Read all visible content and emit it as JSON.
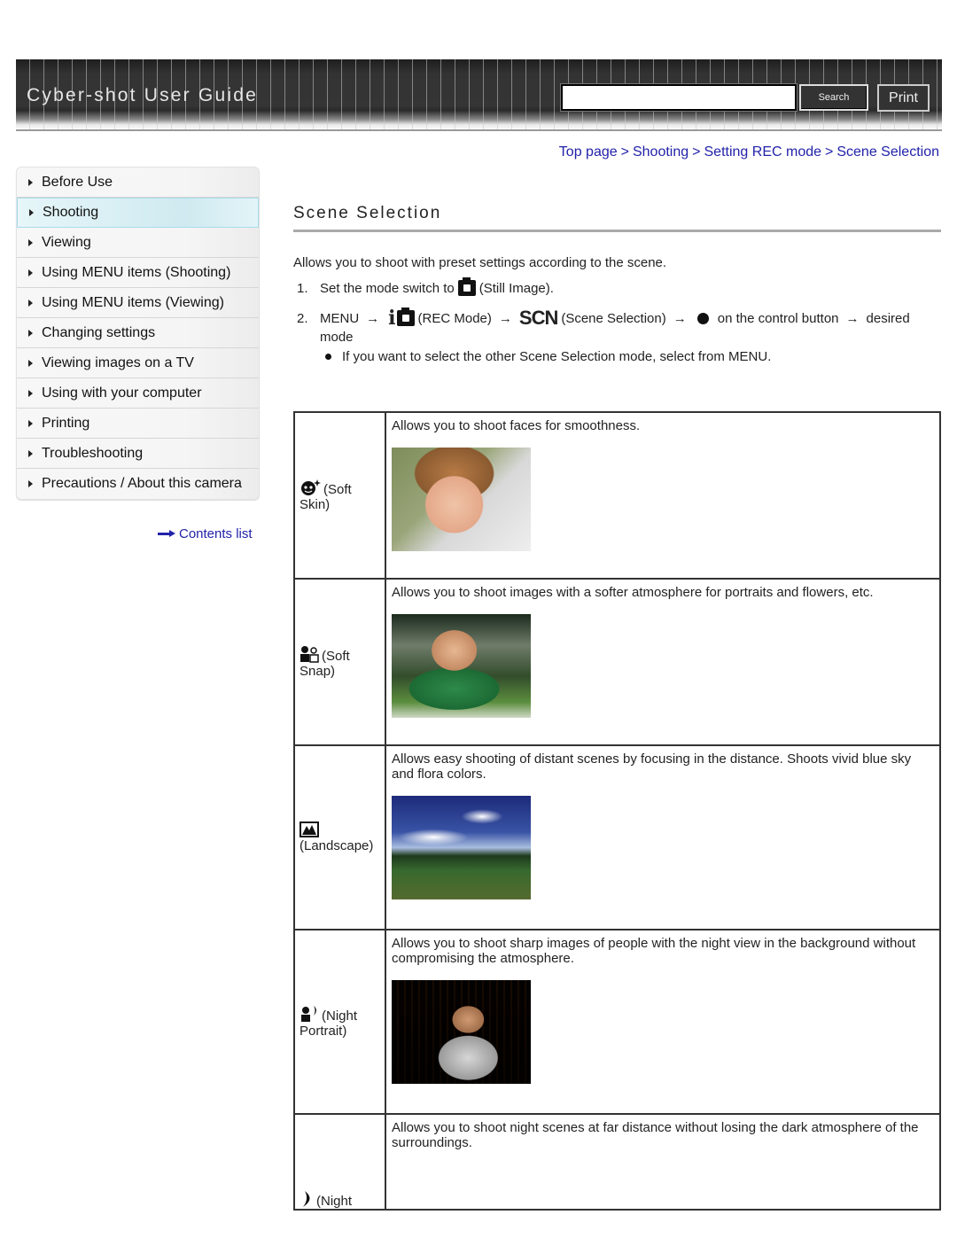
{
  "header": {
    "title": "Cyber-shot User Guide",
    "search_placeholder": "",
    "search_value": "",
    "search_button": "Search",
    "print_button": "Print"
  },
  "breadcrumb": {
    "items": [
      "Top page",
      "Shooting",
      "Setting REC mode",
      "Scene Selection"
    ],
    "separator": ">"
  },
  "sidebar": {
    "items": [
      {
        "label": "Before Use",
        "active": false
      },
      {
        "label": "Shooting",
        "active": true
      },
      {
        "label": "Viewing",
        "active": false
      },
      {
        "label": "Using MENU items (Shooting)",
        "active": false
      },
      {
        "label": "Using MENU items (Viewing)",
        "active": false
      },
      {
        "label": "Changing settings",
        "active": false
      },
      {
        "label": "Viewing images on a TV",
        "active": false
      },
      {
        "label": "Using with your computer",
        "active": false
      },
      {
        "label": "Printing",
        "active": false
      },
      {
        "label": "Troubleshooting",
        "active": false
      },
      {
        "label": "Precautions / About this camera",
        "active": false
      }
    ],
    "contents_link": "Contents list",
    "active_color": "#cfeaf0"
  },
  "main": {
    "title": "Scene Selection",
    "intro": "Allows you to shoot with preset settings according to the scene.",
    "step1": {
      "num": "1.",
      "text_before": "Set the mode switch to",
      "icon": "camera-icon",
      "text_after": "(Still Image)."
    },
    "step2": {
      "num": "2.",
      "menu": "MENU",
      "arrow": "→",
      "rec_icon_text": "i",
      "rec_label": "(REC Mode)",
      "scn_icon_text": "SCN",
      "scn_label": "(Scene Selection)",
      "control_text": "on the control button",
      "desired": "desired",
      "continuation": "mode"
    },
    "note": "If you want to select the other Scene Selection mode, select from MENU.",
    "link_color": "#2222aa"
  },
  "scenes": [
    {
      "icon": "soft-skin-icon",
      "label": "(Soft Skin)",
      "label_line1": "(Soft",
      "label_line2": "Skin)",
      "description": "Allows you to shoot faces for smoothness.",
      "photo": "boy-portrait-photo"
    },
    {
      "icon": "soft-snap-icon",
      "label": "(Soft Snap)",
      "label_line1": "(Soft",
      "label_line2": "Snap)",
      "description": "Allows you to shoot images with a softer atmosphere for portraits and flowers, etc.",
      "photo": "boy-in-grass-photo"
    },
    {
      "icon": "landscape-icon",
      "label": "(Landscape)",
      "label_line1": "",
      "label_line2": "(Landscape)",
      "description": "Allows easy shooting of distant scenes by focusing in the distance. Shoots vivid blue sky and flora colors.",
      "photo": "landscape-photo"
    },
    {
      "icon": "night-portrait-icon",
      "label": "(Night Portrait)",
      "label_line1": "(Night",
      "label_line2": "Portrait)",
      "description": "Allows you to shoot sharp images of people with the night view in the background without compromising the atmosphere.",
      "photo": "night-portrait-photo"
    },
    {
      "icon": "night-scene-icon",
      "label": "(Night",
      "label_line1": "(Night",
      "label_line2": "",
      "description": "Allows you to shoot night scenes at far distance without losing the dark atmosphere of the surroundings.",
      "photo": ""
    }
  ]
}
